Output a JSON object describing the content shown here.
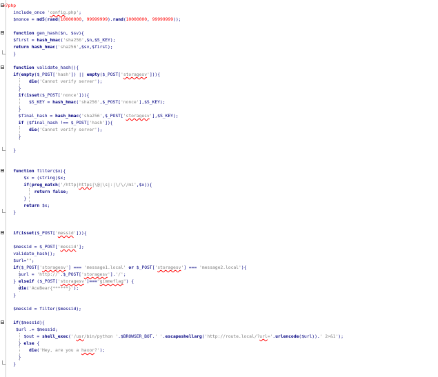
{
  "editor": {
    "lines": [
      [
        [
          "tag",
          "<?php"
        ]
      ],
      [
        [
          "txt",
          "    include_once "
        ],
        [
          "str",
          "'"
        ],
        [
          "sq",
          "config"
        ],
        [
          "str",
          ".php'"
        ],
        [
          "txt",
          ";"
        ]
      ],
      [
        [
          "txt",
          "    $nonce = "
        ],
        [
          "kw",
          "md5"
        ],
        [
          "txt",
          "("
        ],
        [
          "kw",
          "rand"
        ],
        [
          "txt",
          "("
        ],
        [
          "num",
          "10000000"
        ],
        [
          "txt",
          ", "
        ],
        [
          "num",
          "99999999"
        ],
        [
          "txt",
          ")."
        ],
        [
          "kw",
          "rand"
        ],
        [
          "txt",
          "("
        ],
        [
          "num",
          "10000000"
        ],
        [
          "txt",
          ", "
        ],
        [
          "num",
          "99999999"
        ],
        [
          "txt",
          "));"
        ]
      ],
      [],
      [
        [
          "kw",
          "    function"
        ],
        [
          "txt",
          " gen_hash($n, $sv){"
        ]
      ],
      [
        [
          "txt",
          "    $first = "
        ],
        [
          "kw",
          "hash_hmac"
        ],
        [
          "txt",
          "("
        ],
        [
          "str",
          "'sha256'"
        ],
        [
          "txt",
          ",$n,$S_KEY);"
        ]
      ],
      [
        [
          "kw",
          "    return"
        ],
        [
          "txt",
          " "
        ],
        [
          "kw",
          "hash_hmac"
        ],
        [
          "txt",
          "("
        ],
        [
          "str",
          "'sha256'"
        ],
        [
          "txt",
          ",$sv,$first);"
        ]
      ],
      [
        [
          "txt",
          "    }"
        ]
      ],
      [],
      [
        [
          "kw",
          "    function"
        ],
        [
          "txt",
          " validate_hash(){"
        ]
      ],
      [
        [
          "txt",
          "    "
        ],
        [
          "kw",
          "if"
        ],
        [
          "txt",
          "("
        ],
        [
          "kw",
          "empty"
        ],
        [
          "txt",
          "($_POST["
        ],
        [
          "str",
          "'hash'"
        ],
        [
          "txt",
          "]) || "
        ],
        [
          "kw",
          "empty"
        ],
        [
          "txt",
          "($_POST["
        ],
        [
          "str",
          "'"
        ],
        [
          "sq",
          "storagesv"
        ],
        [
          "str",
          "'"
        ],
        [
          "txt",
          "])){"
        ]
      ],
      [
        [
          "txt",
          "          "
        ],
        [
          "kw",
          "die"
        ],
        [
          "txt",
          "("
        ],
        [
          "str",
          "'Cannot verify server'"
        ],
        [
          "txt",
          ");"
        ]
      ],
      [
        [
          "txt",
          "      }"
        ]
      ],
      [
        [
          "txt",
          "      "
        ],
        [
          "kw",
          "if"
        ],
        [
          "txt",
          "("
        ],
        [
          "kw",
          "isset"
        ],
        [
          "txt",
          "($_POST["
        ],
        [
          "str",
          "'nonce'"
        ],
        [
          "txt",
          "])){"
        ]
      ],
      [
        [
          "txt",
          "          $S_KEY = "
        ],
        [
          "kw",
          "hash_hmac"
        ],
        [
          "txt",
          "("
        ],
        [
          "str",
          "'sha256'"
        ],
        [
          "txt",
          ",$_POST["
        ],
        [
          "str",
          "'nonce'"
        ],
        [
          "txt",
          "],$S_KEY);"
        ]
      ],
      [
        [
          "txt",
          "      }"
        ]
      ],
      [
        [
          "txt",
          "      $final_hash = "
        ],
        [
          "kw",
          "hash_hmac"
        ],
        [
          "txt",
          "("
        ],
        [
          "str",
          "'sha256'"
        ],
        [
          "txt",
          ",$_POST["
        ],
        [
          "str",
          "'"
        ],
        [
          "sq",
          "storagesv"
        ],
        [
          "str",
          "'"
        ],
        [
          "txt",
          "],$S_KEY);"
        ]
      ],
      [
        [
          "txt",
          "      "
        ],
        [
          "kw",
          "if"
        ],
        [
          "txt",
          " ($final_hash !== $_POST["
        ],
        [
          "str",
          "'hash'"
        ],
        [
          "txt",
          "]){"
        ]
      ],
      [
        [
          "txt",
          "          "
        ],
        [
          "kw",
          "die"
        ],
        [
          "txt",
          "("
        ],
        [
          "str",
          "'Cannot verify server'"
        ],
        [
          "txt",
          ");"
        ]
      ],
      [
        [
          "txt",
          "      }"
        ]
      ],
      [],
      [
        [
          "txt",
          "    }"
        ]
      ],
      [],
      [],
      [
        [
          "kw",
          "    function"
        ],
        [
          "txt",
          " filter($x){"
        ]
      ],
      [
        [
          "txt",
          "        $x = (string)$x;"
        ]
      ],
      [
        [
          "txt",
          "        "
        ],
        [
          "kw",
          "if"
        ],
        [
          "txt",
          "("
        ],
        [
          "kw",
          "preg_match"
        ],
        [
          "txt",
          "("
        ],
        [
          "str",
          "'/http|"
        ],
        [
          "sq",
          "https"
        ],
        [
          "str",
          "|\\@|\\s|:|\\/\\//mi'"
        ],
        [
          "txt",
          ",$x)){"
        ]
      ],
      [
        [
          "txt",
          "            "
        ],
        [
          "kw",
          "return"
        ],
        [
          "txt",
          " "
        ],
        [
          "kw",
          "false"
        ],
        [
          "txt",
          ";"
        ]
      ],
      [
        [
          "txt",
          "        }"
        ]
      ],
      [
        [
          "txt",
          "        "
        ],
        [
          "kw",
          "return"
        ],
        [
          "txt",
          " $x;"
        ]
      ],
      [
        [
          "txt",
          "    }"
        ]
      ],
      [],
      [],
      [
        [
          "txt",
          "    "
        ],
        [
          "kw",
          "if"
        ],
        [
          "txt",
          "("
        ],
        [
          "kw",
          "isset"
        ],
        [
          "txt",
          "($_POST["
        ],
        [
          "str",
          "'"
        ],
        [
          "sq",
          "messid"
        ],
        [
          "str",
          "'"
        ],
        [
          "txt",
          "])){"
        ]
      ],
      [],
      [
        [
          "txt",
          "    $messid = $_POST["
        ],
        [
          "str",
          "'"
        ],
        [
          "sq",
          "messid"
        ],
        [
          "str",
          "'"
        ],
        [
          "txt",
          "];"
        ]
      ],
      [
        [
          "txt",
          "    validate_hash();"
        ]
      ],
      [
        [
          "txt",
          "    $url="
        ],
        [
          "str",
          "\"\""
        ],
        [
          "txt",
          ";"
        ]
      ],
      [
        [
          "txt",
          "    "
        ],
        [
          "kw",
          "if"
        ],
        [
          "txt",
          "($_POST["
        ],
        [
          "str",
          "'"
        ],
        [
          "sq",
          "storagesv"
        ],
        [
          "str",
          "'"
        ],
        [
          "txt",
          "] === "
        ],
        [
          "str",
          "'message1.local'"
        ],
        [
          "txt",
          " "
        ],
        [
          "kw",
          "or"
        ],
        [
          "txt",
          " $_POST["
        ],
        [
          "str",
          "'"
        ],
        [
          "sq",
          "storagesv"
        ],
        [
          "str",
          "'"
        ],
        [
          "txt",
          "] === "
        ],
        [
          "str",
          "'message2.local'"
        ],
        [
          "txt",
          "){"
        ]
      ],
      [
        [
          "txt",
          "      $url = "
        ],
        [
          "str",
          "'http://'"
        ],
        [
          "txt",
          ".$_POST["
        ],
        [
          "str",
          "'"
        ],
        [
          "sq",
          "storagesv"
        ],
        [
          "str",
          "'"
        ],
        [
          "txt",
          "]."
        ],
        [
          "str",
          "'/'"
        ],
        [
          "txt",
          ";"
        ]
      ],
      [
        [
          "txt",
          "    } "
        ],
        [
          "kw",
          "elseif"
        ],
        [
          "txt",
          " ($_POST["
        ],
        [
          "str",
          "'"
        ],
        [
          "sq",
          "storagesv"
        ],
        [
          "str",
          "'"
        ],
        [
          "txt",
          "]==="
        ],
        [
          "str",
          "\""
        ],
        [
          "sq",
          "gimmeflag"
        ],
        [
          "str",
          "\""
        ],
        [
          "txt",
          ") {"
        ]
      ],
      [
        [
          "txt",
          "      "
        ],
        [
          "kw",
          "die"
        ],
        [
          "txt",
          "("
        ],
        [
          "str",
          "'AceBear{******}'"
        ],
        [
          "txt",
          ");"
        ]
      ],
      [
        [
          "txt",
          "    }"
        ]
      ],
      [],
      [
        [
          "txt",
          "    $messid = filter($messid);"
        ]
      ],
      [],
      [
        [
          "txt",
          "    "
        ],
        [
          "kw",
          "if"
        ],
        [
          "txt",
          "($messid){"
        ]
      ],
      [
        [
          "txt",
          "     $url .= $messid;"
        ]
      ],
      [
        [
          "txt",
          "        $out = "
        ],
        [
          "kw",
          "shell_exec"
        ],
        [
          "txt",
          "("
        ],
        [
          "str",
          "'/"
        ],
        [
          "sq",
          "usr"
        ],
        [
          "str",
          "/bin/python '"
        ],
        [
          "txt",
          ".$BROWSER_BOT."
        ],
        [
          "str",
          "' '"
        ],
        [
          "txt",
          "."
        ],
        [
          "kw",
          "escapeshellarg"
        ],
        [
          "txt",
          "("
        ],
        [
          "str",
          "'http://route.local/?"
        ],
        [
          "sq",
          "url"
        ],
        [
          "str",
          "='"
        ],
        [
          "txt",
          "."
        ],
        [
          "kw",
          "urlencode"
        ],
        [
          "txt",
          "($url))."
        ],
        [
          "str",
          "' 2>&1'"
        ],
        [
          "txt",
          ");"
        ]
      ],
      [
        [
          "txt",
          "      } "
        ],
        [
          "kw",
          "else"
        ],
        [
          "txt",
          " {"
        ]
      ],
      [
        [
          "txt",
          "          "
        ],
        [
          "kw",
          "die"
        ],
        [
          "txt",
          "("
        ],
        [
          "str",
          "'Hey, are you a "
        ],
        [
          "sq",
          "haxor"
        ],
        [
          "str",
          "?'"
        ],
        [
          "txt",
          ");"
        ]
      ],
      [
        [
          "txt",
          "      }"
        ]
      ],
      [
        [
          "txt",
          "    }"
        ]
      ],
      [],
      [],
      [
        [
          "tag",
          "?>"
        ]
      ]
    ]
  },
  "colors": {
    "keyword": "#000080",
    "identifier": "#000080",
    "string": "#808080",
    "number": "#ff0000",
    "php_tag": "#ff0000",
    "spellcheck": "#ff0000"
  }
}
